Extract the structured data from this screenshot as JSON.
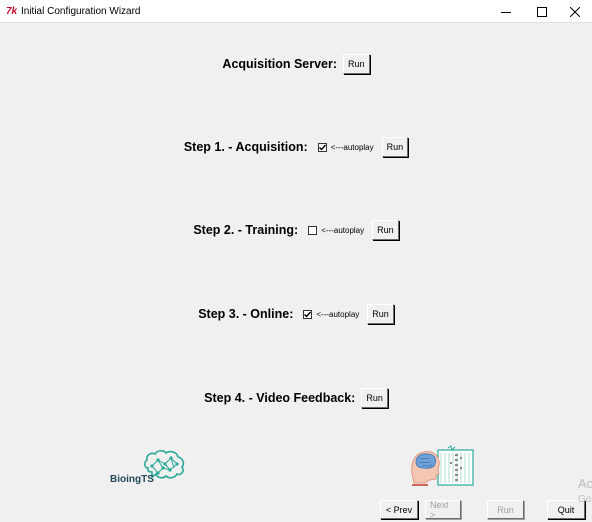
{
  "window": {
    "title": "Initial Configuration Wizard",
    "app_icon": "7k"
  },
  "rows": [
    {
      "label": "Acquisition Server:",
      "run": "Run"
    },
    {
      "label": "Step 1. - Acquisition:",
      "autoplay": "<---autoplay",
      "checked": true,
      "run": "Run"
    },
    {
      "label": "Step 2. - Training:",
      "autoplay": "<---autoplay",
      "checked": false,
      "run": "Run"
    },
    {
      "label": "Step 3. - Online:",
      "autoplay": "<---autoplay",
      "checked": true,
      "run": "Run"
    },
    {
      "label": "Step 4. - Video Feedback:",
      "run": "Run"
    }
  ],
  "logos": {
    "left_text": "BioingTS"
  },
  "nav": {
    "prev": "< Prev",
    "next": "Next >",
    "run": "Run",
    "quit": "Quit"
  },
  "overlay": {
    "activate_1": "Ac",
    "activate_2": "Go"
  },
  "colors": {
    "logo_teal": "#2aa99a",
    "logo_navy": "#24475a",
    "checkbox_mark": "#000000"
  }
}
